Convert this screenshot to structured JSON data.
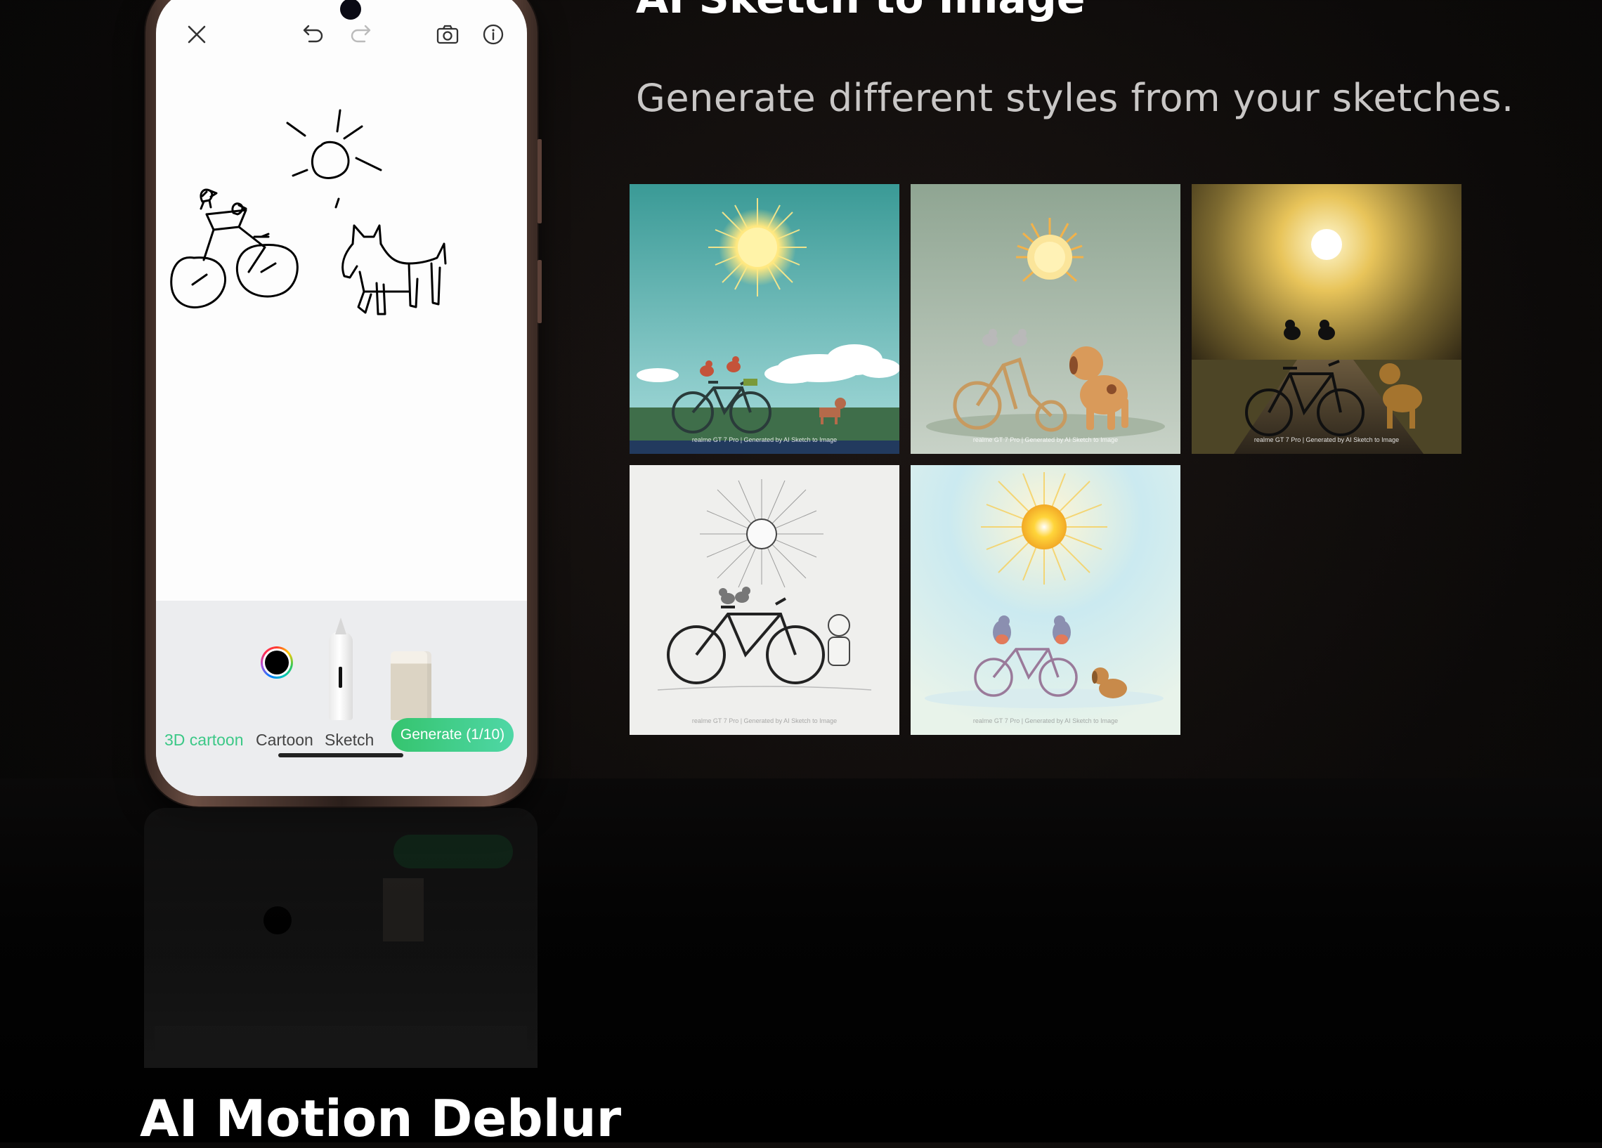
{
  "page": {
    "title": "AI Sketch to Image",
    "subtitle": "Generate different styles from your sketches.",
    "next_section_heading": "AI Motion Deblur"
  },
  "phone_app": {
    "toolbar_icons": [
      "close-icon",
      "undo-icon",
      "redo-icon",
      "camera-icon",
      "info-icon"
    ],
    "tools": [
      "color-picker",
      "pen-tool",
      "eraser-tool"
    ],
    "styles": [
      {
        "label": "3D cartoon",
        "active": true
      },
      {
        "label": "Cartoon",
        "active": false
      },
      {
        "label": "Sketch",
        "active": false
      }
    ],
    "generate_button": "Generate (1/10)",
    "accent_color": "#3cc887"
  },
  "gallery": {
    "watermark": "realme GT 7 Pro  |  Generated by AI Sketch to Image",
    "tiles": [
      {
        "style": "teal-sky-cartoon"
      },
      {
        "style": "sage-3d-cartoon"
      },
      {
        "style": "golden-photo"
      },
      {
        "style": "pencil-sketch"
      },
      {
        "style": "pastel-watercolor"
      }
    ]
  }
}
